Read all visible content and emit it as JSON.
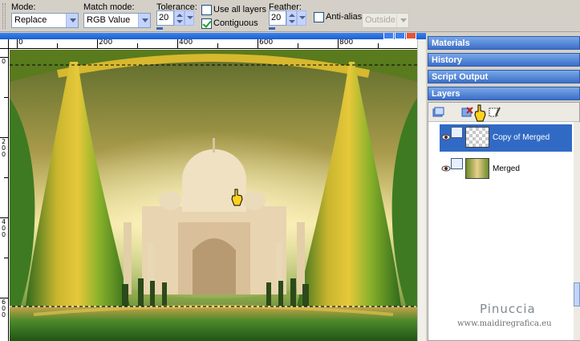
{
  "toolbar": {
    "mode": {
      "label": "Mode:",
      "value": "Replace"
    },
    "match_mode": {
      "label": "Match mode:",
      "value": "RGB Value"
    },
    "tolerance": {
      "label": "Tolerance:",
      "value": "20",
      "level": 0.2
    },
    "use_all_layers": {
      "label": "Use all layers",
      "checked": false
    },
    "contiguous": {
      "label": "Contiguous",
      "checked": true
    },
    "feather": {
      "label": "Feather:",
      "value": "20",
      "level": 0.2
    },
    "anti_alias": {
      "label": "Anti-alias",
      "checked": false
    },
    "inside_outside": {
      "value": "Outside",
      "disabled": true
    }
  },
  "ruler": {
    "top_labels": [
      "0",
      "200",
      "400",
      "600",
      "800"
    ],
    "left_labels": [
      [
        "0"
      ],
      [
        "2",
        "0",
        "0"
      ],
      [
        "4",
        "0",
        "0"
      ],
      [
        "6",
        "0",
        "0"
      ]
    ]
  },
  "panels": {
    "materials": "Materials",
    "history": "History",
    "script_output": "Script Output",
    "layers": "Layers"
  },
  "layers": [
    {
      "name": "Copy of Merged",
      "selected": true,
      "transparent": true
    },
    {
      "name": "Merged",
      "selected": false,
      "transparent": false
    }
  ],
  "watermark": {
    "name": "Pinuccia",
    "url": "www.maidiregrafica.eu"
  },
  "icons": [
    "eye-icon",
    "hand-cursor-icon",
    "new-layer-icon",
    "delete-layer-icon",
    "mask-icon"
  ],
  "colors": {
    "accent": "#316ac5",
    "panel_header": "#3c6fc8",
    "toolbar_bg": "#d4d0c8"
  }
}
